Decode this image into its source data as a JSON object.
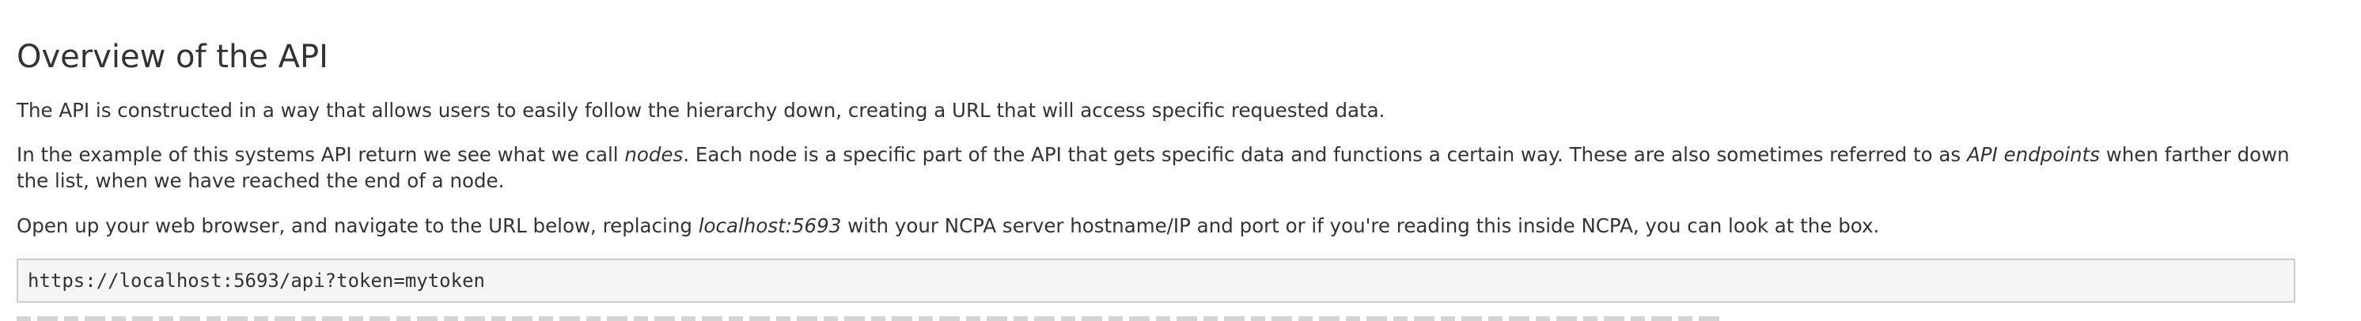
{
  "section": {
    "title": "Overview of the API"
  },
  "paragraphs": {
    "p1": "The API is constructed in a way that allows users to easily follow the hierarchy down, creating a URL that will access specific requested data.",
    "p2_part1": "In the example of this systems API return we see what we call ",
    "p2_em1": "nodes",
    "p2_part2": ". Each node is a specific part of the API that gets specific data and functions a certain way. These are also sometimes referred to as ",
    "p2_em2": "API endpoints",
    "p2_part3": " when farther down the list, when we have reached the end of a node.",
    "p3_part1": "Open up your web browser, and navigate to the URL below, replacing ",
    "p3_em1": "localhost:5693",
    "p3_part2": " with your NCPA server hostname/IP and port or if you're reading this inside NCPA, you can look at the box."
  },
  "code": {
    "url": "https://localhost:5693/api?token=mytoken"
  },
  "colors": {
    "text": "#333333",
    "code_background": "#f5f5f5",
    "code_border": "#cccccc"
  }
}
